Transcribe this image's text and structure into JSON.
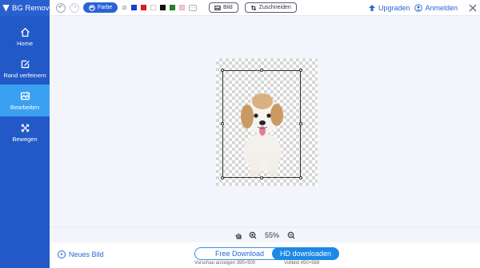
{
  "app": {
    "title": "BG Remover"
  },
  "sidebar": {
    "items": [
      {
        "label": "Home",
        "icon": "home-icon"
      },
      {
        "label": "Rand verfeinern",
        "icon": "edit-icon"
      },
      {
        "label": "Bearbeiten",
        "icon": "image-edit-icon",
        "active": true
      },
      {
        "label": "Bewegen",
        "icon": "move-icon"
      }
    ]
  },
  "toolbar": {
    "color_label": "Farbe",
    "swatches": [
      "#1a3ddb",
      "#e11d1d",
      "#ffffff",
      "#111111",
      "#1a8a2a",
      "#f6c3d0"
    ],
    "image_label": "Bild",
    "crop_label": "Zuschneiden",
    "more_label": "···"
  },
  "header": {
    "upgrade_label": "Upgraden",
    "login_label": "Anmelden"
  },
  "zoom": {
    "value": "55%"
  },
  "bottom": {
    "new_image_label": "Neues Bild",
    "free_download_label": "Free Download",
    "free_download_note": "Vorschau anzeigen 395×500",
    "hd_download_label": "HD downloaden",
    "hd_download_note": "Vollbild 450×569"
  },
  "colors": {
    "accent": "#2a64d6",
    "sidebar": "#2358c7",
    "sidebar_active": "#3aa1f2"
  }
}
